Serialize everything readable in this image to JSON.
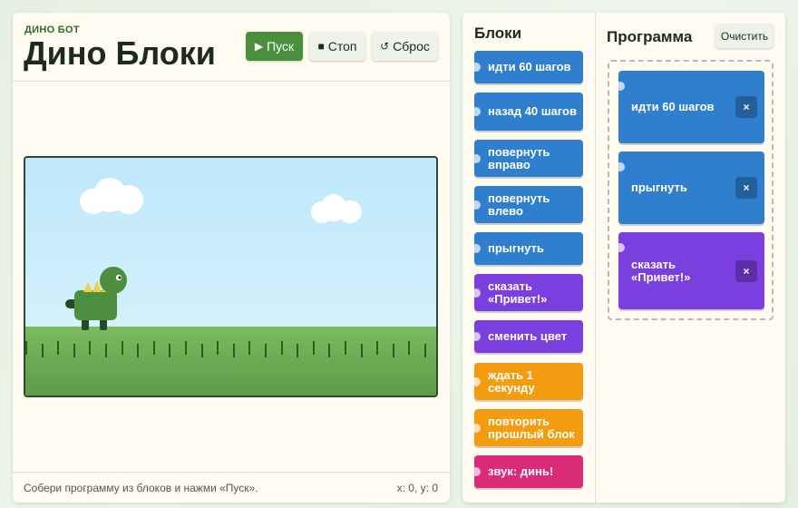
{
  "header": {
    "subtitle": "ДИНО БОТ",
    "title": "Дино Блоки"
  },
  "controls": {
    "run_icon": "▶",
    "run_label": "Пуск",
    "stop_icon": "■",
    "stop_label": "Стоп",
    "reset_icon": "↺",
    "reset_label": "Сброс"
  },
  "footer": {
    "hint": "Собери программу из блоков и нажми «Пуск».",
    "coords": "x: 0, y: 0"
  },
  "palette": {
    "title": "Блоки",
    "blocks": [
      {
        "label": "идти 60 шагов",
        "category": "motion"
      },
      {
        "label": "назад 40 шагов",
        "category": "motion"
      },
      {
        "label": "повернуть вправо",
        "category": "motion"
      },
      {
        "label": "повернуть влево",
        "category": "motion"
      },
      {
        "label": "прыгнуть",
        "category": "motion"
      },
      {
        "label": "сказать «Привет!»",
        "category": "looks"
      },
      {
        "label": "сменить цвет",
        "category": "looks"
      },
      {
        "label": "ждать 1 секунду",
        "category": "control"
      },
      {
        "label": "повторить прошлый блок",
        "category": "control"
      },
      {
        "label": "звук: динь!",
        "category": "sound"
      }
    ]
  },
  "program": {
    "title": "Программа",
    "clear_label": "Очистить",
    "delete_icon": "×",
    "blocks": [
      {
        "label": "идти 60 шагов",
        "category": "motion"
      },
      {
        "label": "прыгнуть",
        "category": "motion"
      },
      {
        "label": "сказать «Привет!»",
        "category": "looks"
      }
    ]
  },
  "colors": {
    "motion": "#2f7fce",
    "looks": "#7b3fe0",
    "control": "#f39c0f",
    "sound": "#db2a77",
    "run_button": "#4a8f3c"
  }
}
